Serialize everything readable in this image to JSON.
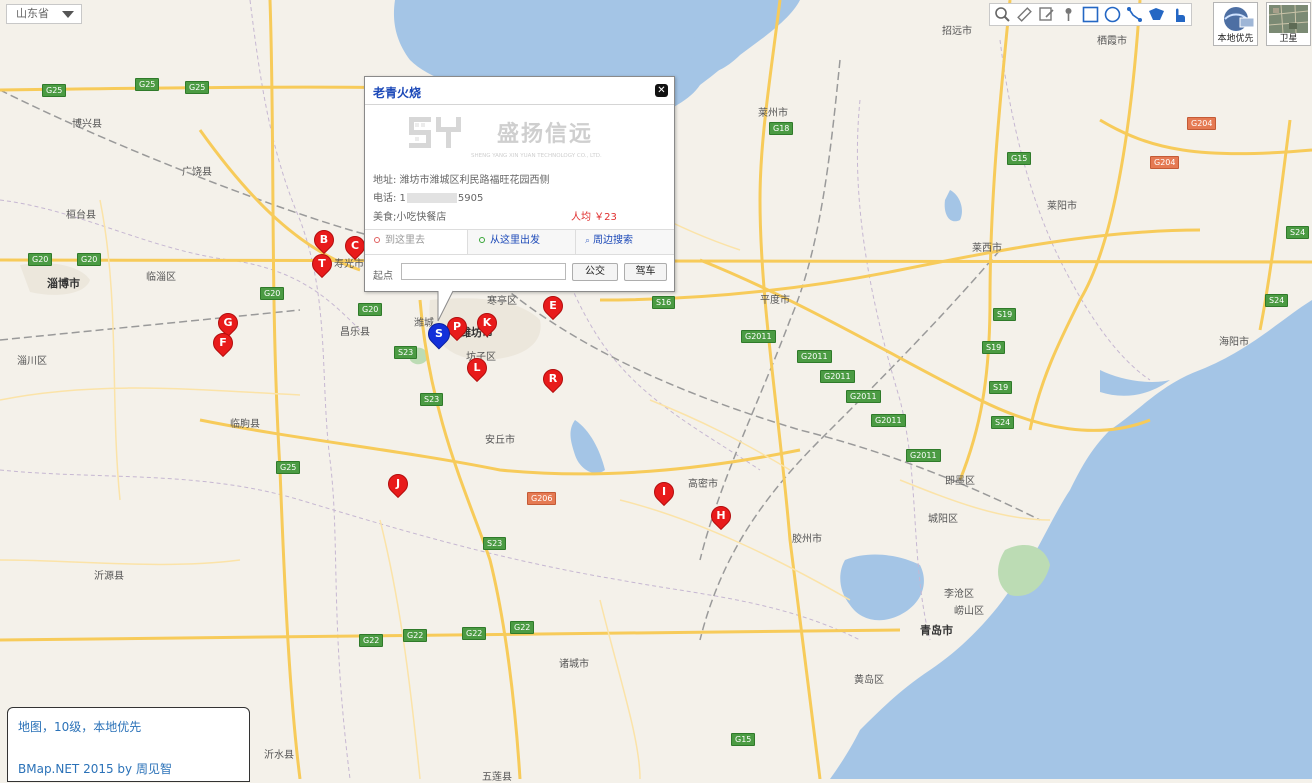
{
  "province_select": {
    "value": "山东省"
  },
  "toolbar": {
    "tools": [
      "zoom-search-icon",
      "ruler-icon",
      "area-measure-icon",
      "pin-icon",
      "rectangle-icon",
      "circle-icon",
      "polyline-icon",
      "polygon-icon",
      "hand-icon"
    ]
  },
  "map_types": {
    "local_priority": "本地优先",
    "satellite": "卫星"
  },
  "place_labels": [
    {
      "text": "招远市"
    },
    {
      "text": "栖霞市"
    },
    {
      "text": "博兴县"
    },
    {
      "text": "莱州市"
    },
    {
      "text": "广饶县"
    },
    {
      "text": "桓台县"
    },
    {
      "text": "莱阳市"
    },
    {
      "text": "淄博市"
    },
    {
      "text": "临淄区"
    },
    {
      "text": "莱西市"
    },
    {
      "text": "平度市"
    },
    {
      "text": "昌乐县"
    },
    {
      "text": "潍城"
    },
    {
      "text": "潍坊市"
    },
    {
      "text": "寒亭区"
    },
    {
      "text": "坊子区"
    },
    {
      "text": "海阳市"
    },
    {
      "text": "淄川区"
    },
    {
      "text": "临朐县"
    },
    {
      "text": "安丘市"
    },
    {
      "text": "即墨区"
    },
    {
      "text": "高密市"
    },
    {
      "text": "城阳区"
    },
    {
      "text": "胶州市"
    },
    {
      "text": "沂源县"
    },
    {
      "text": "李沧区"
    },
    {
      "text": "崂山区"
    },
    {
      "text": "青岛市"
    },
    {
      "text": "诸城市"
    },
    {
      "text": "黄岛区"
    },
    {
      "text": "沂水县"
    },
    {
      "text": "五莲县"
    },
    {
      "text": "寿光市"
    }
  ],
  "road_shields": [
    {
      "text": "G25"
    },
    {
      "text": "G25"
    },
    {
      "text": "G25"
    },
    {
      "text": "G18"
    },
    {
      "text": "G204"
    },
    {
      "text": "G15"
    },
    {
      "text": "G204"
    },
    {
      "text": "G20"
    },
    {
      "text": "G20"
    },
    {
      "text": "G20"
    },
    {
      "text": "G20"
    },
    {
      "text": "S16"
    },
    {
      "text": "S23"
    },
    {
      "text": "G2011"
    },
    {
      "text": "G2011"
    },
    {
      "text": "G2011"
    },
    {
      "text": "G2011"
    },
    {
      "text": "G2011"
    },
    {
      "text": "G2011"
    },
    {
      "text": "S19"
    },
    {
      "text": "S19"
    },
    {
      "text": "S19"
    },
    {
      "text": "S24"
    },
    {
      "text": "S24"
    },
    {
      "text": "S23"
    },
    {
      "text": "G25"
    },
    {
      "text": "G206"
    },
    {
      "text": "S23"
    },
    {
      "text": "G22"
    },
    {
      "text": "G22"
    },
    {
      "text": "G22"
    },
    {
      "text": "G22"
    },
    {
      "text": "G15"
    },
    {
      "text": "S24"
    }
  ],
  "markers": [
    {
      "letter": "B",
      "color": "#e81b1b"
    },
    {
      "letter": "C",
      "color": "#e81b1b"
    },
    {
      "letter": "T",
      "color": "#e81b1b"
    },
    {
      "letter": "G",
      "color": "#e81b1b"
    },
    {
      "letter": "F",
      "color": "#e81b1b"
    },
    {
      "letter": "E",
      "color": "#e81b1b"
    },
    {
      "letter": "P",
      "color": "#e81b1b"
    },
    {
      "letter": "K",
      "color": "#e81b1b"
    },
    {
      "letter": "L",
      "color": "#e81b1b"
    },
    {
      "letter": "R",
      "color": "#e81b1b"
    },
    {
      "letter": "J",
      "color": "#e81b1b"
    },
    {
      "letter": "I",
      "color": "#e81b1b"
    },
    {
      "letter": "H",
      "color": "#e81b1b"
    },
    {
      "letter": "S",
      "color": "#1330d9"
    }
  ],
  "info_window": {
    "title": "老青火烧",
    "logo_text": "盛扬信远",
    "logo_subtext": "SHENG YANG XIN YUAN TECHNOLOGY CO., LTD.",
    "address": "地址: 潍坊市潍城区利民路福旺花园西侧",
    "phone": "电话: 1",
    "phone_tail": "5905",
    "category": "美食;小吃快餐店",
    "price": "人均 ￥23",
    "tab_to_here": "到这里去",
    "tab_from_here": "从这里出发",
    "tab_nearby": "周边搜索",
    "start_label": "起点",
    "bus_button": "公交",
    "drive_button": "驾车"
  },
  "status_box": {
    "line1": "地图，10级，本地优先",
    "line2": "BMap.NET 2015 by 周见智"
  },
  "colors": {
    "land": "#f4f1ea",
    "sea": "#a4c5e6",
    "road_major": "#f7cb5a",
    "road_minor": "#fbe3a8",
    "marker_red": "#e81b1b",
    "marker_blue": "#1330d9",
    "link_blue": "#2b72b8"
  }
}
